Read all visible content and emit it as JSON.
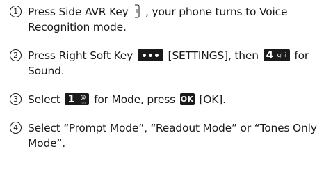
{
  "steps": [
    {
      "number": "1",
      "text_a": "Press Side AVR Key",
      "text_b": ", your phone turns to Voice Recognition mode."
    },
    {
      "number": "2",
      "text_a": "Press Right Soft Key",
      "text_b": "[SETTINGS], then",
      "key_digit": "4",
      "key_letters": "ghi",
      "text_c": "for Sound."
    },
    {
      "number": "3",
      "text_a": "Select",
      "key_digit": "1",
      "text_b": "for Mode, press",
      "ok_label": "OK",
      "text_c": "[OK]."
    },
    {
      "number": "4",
      "text_a": "Select “Prompt Mode”, “Readout Mode” or “Tones Only Mode”."
    }
  ],
  "icons": {
    "side_key": "side-avr-key-icon",
    "soft_key": "right-soft-key-dots-icon",
    "four_key": "keypad-4-ghi-icon",
    "one_key": "keypad-1-voicemail-icon",
    "ok_key": "ok-key-icon"
  }
}
